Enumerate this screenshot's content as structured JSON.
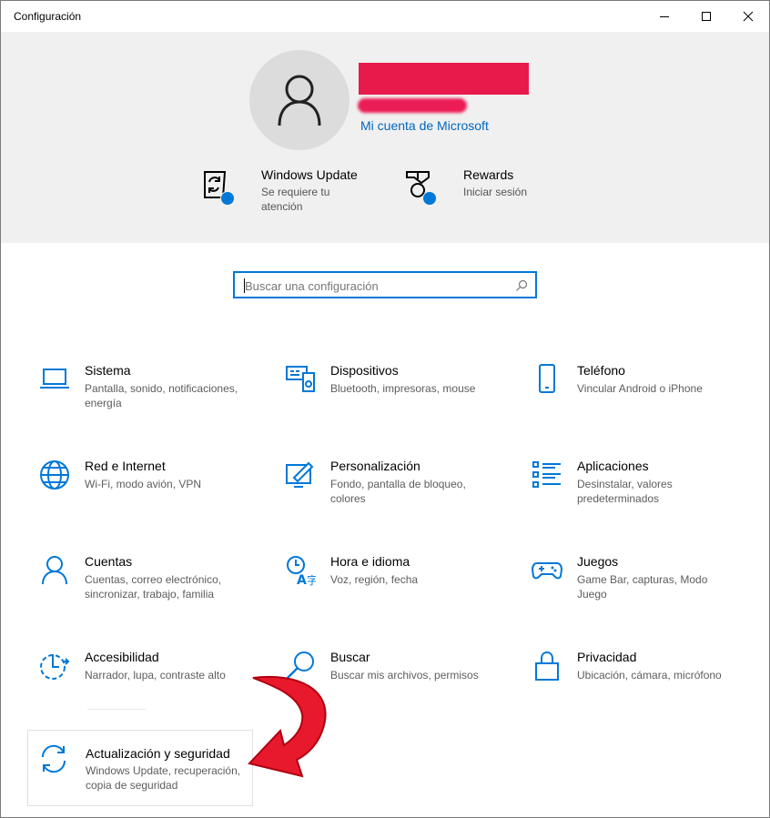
{
  "window": {
    "title": "Configuración"
  },
  "account": {
    "link": "Mi cuenta de Microsoft"
  },
  "quick": [
    {
      "title": "Windows Update",
      "subtitle_1": "Se requiere tu",
      "subtitle_2": "atención"
    },
    {
      "title": "Rewards",
      "subtitle_1": "Iniciar sesión"
    }
  ],
  "search": {
    "placeholder": "Buscar una configuración"
  },
  "tiles": [
    {
      "title": "Sistema",
      "subtitle_1": "Pantalla, sonido, notificaciones,",
      "subtitle_2": "energía",
      "icon": "laptop-icon"
    },
    {
      "title": "Dispositivos",
      "subtitle_1": "Bluetooth, impresoras, mouse",
      "icon": "devices-icon"
    },
    {
      "title": "Teléfono",
      "subtitle_1": "Vincular Android o iPhone",
      "icon": "phone-icon"
    },
    {
      "title": "Red e Internet",
      "subtitle_1": "Wi-Fi, modo avión, VPN",
      "icon": "globe-icon"
    },
    {
      "title": "Personalización",
      "subtitle_1": "Fondo, pantalla de bloqueo,",
      "subtitle_2": "colores",
      "icon": "personalization-icon"
    },
    {
      "title": "Aplicaciones",
      "subtitle_1": "Desinstalar, valores",
      "subtitle_2": "predeterminados",
      "icon": "apps-icon"
    },
    {
      "title": "Cuentas",
      "subtitle_1": "Cuentas, correo electrónico,",
      "subtitle_2": "sincronizar, trabajo, familia",
      "icon": "person-icon"
    },
    {
      "title": "Hora e idioma",
      "subtitle_1": "Voz, región, fecha",
      "icon": "time-language-icon"
    },
    {
      "title": "Juegos",
      "subtitle_1": "Game Bar, capturas, Modo",
      "subtitle_2": "Juego",
      "icon": "gamepad-icon"
    },
    {
      "title": "Accesibilidad",
      "subtitle_1": "Narrador, lupa, contraste alto",
      "icon": "accessibility-icon"
    },
    {
      "title": "Buscar",
      "subtitle_1": "Buscar mis archivos, permisos",
      "icon": "search-icon"
    },
    {
      "title": "Privacidad",
      "subtitle_1": "Ubicación, cámara, micrófono",
      "icon": "lock-icon"
    },
    {
      "title": "Actualización y seguridad",
      "subtitle_1": "Windows Update, recuperación,",
      "subtitle_2": "copia de seguridad",
      "icon": "sync-icon"
    }
  ],
  "colors": {
    "accent": "#0078d7",
    "header_bg": "#f0f0f0",
    "annotation_arrow": "#e8192c"
  }
}
